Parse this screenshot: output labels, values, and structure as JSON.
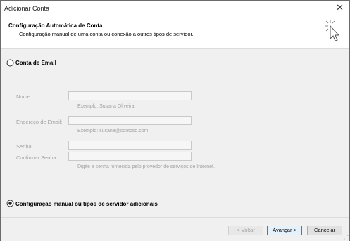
{
  "window": {
    "title": "Adicionar Conta"
  },
  "header": {
    "title": "Configuração Automática de Conta",
    "subtitle": "Configuração manual de uma conta ou conexão a outros tipos de servidor."
  },
  "options": {
    "email_account": {
      "label": "Conta de Email",
      "selected": false
    },
    "manual_config": {
      "label": "Configuração manual ou tipos de servidor adicionais",
      "selected": true
    }
  },
  "form": {
    "name_label": "Nome:",
    "name_value": "",
    "name_hint": "Exemplo: Susana Oliveira",
    "email_label": "Endereço de Email:",
    "email_value": "",
    "email_hint": "Exemplo: susana@contoso.com",
    "password_label": "Senha:",
    "password_value": "",
    "confirm_label": "Confirmar Senha:",
    "confirm_value": "",
    "password_hint": "Digite a senha fornecida pelo provedor de serviços de Internet."
  },
  "buttons": {
    "back": "< Voltar",
    "next": "Avançar >",
    "cancel": "Cancelar"
  },
  "icons": {
    "close": "close-icon",
    "wizard": "magic-cursor-icon"
  },
  "colors": {
    "next_border": "#3c7fb1",
    "disabled_text": "#a3a3a3"
  }
}
